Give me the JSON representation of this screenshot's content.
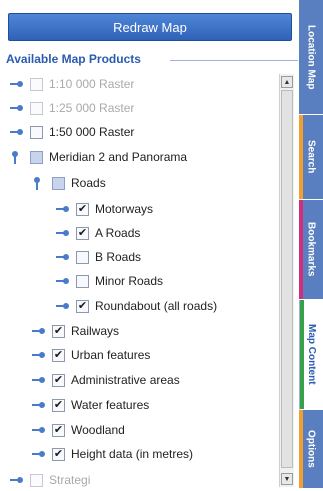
{
  "header": {
    "redraw_label": "Redraw Map"
  },
  "products": {
    "title": "Available Map Products",
    "items": [
      {
        "label": "1:10 000 Raster",
        "checked": false,
        "dim": true
      },
      {
        "label": "1:25 000 Raster",
        "checked": false,
        "dim": true
      },
      {
        "label": "1:50 000 Raster",
        "checked": false,
        "dim": false
      },
      {
        "label": "Meridian 2 and Panorama",
        "checked": false,
        "dim": false
      },
      {
        "label": "Roads",
        "checked": false,
        "dim": false
      },
      {
        "label": "Motorways",
        "checked": true,
        "dim": false
      },
      {
        "label": "A Roads",
        "checked": true,
        "dim": false
      },
      {
        "label": "B Roads",
        "checked": false,
        "dim": false
      },
      {
        "label": "Minor Roads",
        "checked": false,
        "dim": false
      },
      {
        "label": "Roundabout (all roads)",
        "checked": true,
        "dim": false
      },
      {
        "label": "Railways",
        "checked": true,
        "dim": false
      },
      {
        "label": "Urban features",
        "checked": true,
        "dim": false
      },
      {
        "label": "Administrative areas",
        "checked": true,
        "dim": false
      },
      {
        "label": "Water features",
        "checked": true,
        "dim": false
      },
      {
        "label": "Woodland",
        "checked": true,
        "dim": false
      },
      {
        "label": "Height data (in metres)",
        "checked": true,
        "dim": false
      },
      {
        "label": "Strategi",
        "checked": false,
        "dim": true
      }
    ]
  },
  "tabs": [
    {
      "label": "Location Map",
      "stripe": "#5a7fc0"
    },
    {
      "label": "Search",
      "stripe": "#f0a030"
    },
    {
      "label": "Bookmarks",
      "stripe": "#d0307a"
    },
    {
      "label": "Map Content",
      "stripe": "#36a04a",
      "active": true
    },
    {
      "label": "Options",
      "stripe": "#f0a030"
    }
  ],
  "colors": {
    "accent": "#2f62b8",
    "tab_background": "#5a7fc0"
  }
}
